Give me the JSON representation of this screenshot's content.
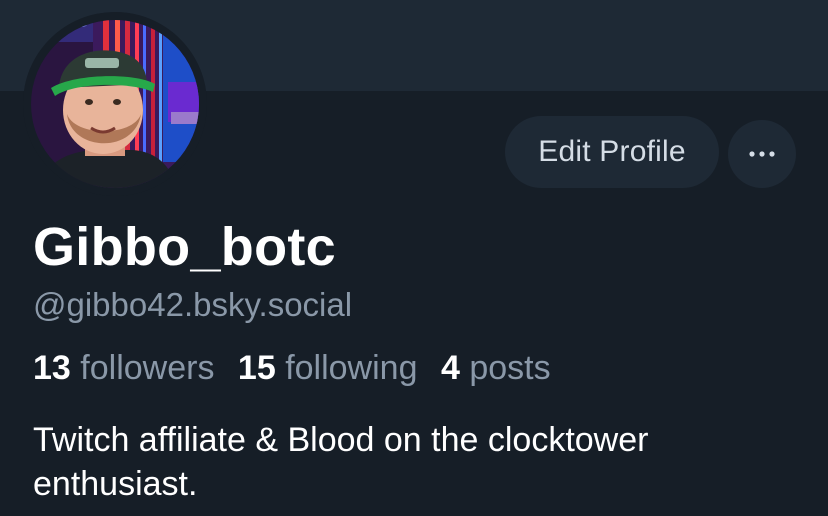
{
  "profile": {
    "display_name": "Gibbo_botc",
    "handle": "@gibbo42.bsky.social",
    "bio": "Twitch affiliate & Blood on the clocktower enthusiast.",
    "avatar_icon": "user-avatar-photo"
  },
  "actions": {
    "edit_profile_label": "Edit Profile",
    "more_icon": "ellipsis-icon"
  },
  "stats": {
    "followers_count": "13",
    "followers_label": "followers",
    "following_count": "15",
    "following_label": "following",
    "posts_count": "4",
    "posts_label": "posts"
  },
  "colors": {
    "background": "#161e27",
    "banner": "#1e2935",
    "button_bg": "#1e2935",
    "muted_text": "#8a98a8",
    "primary_text": "#ffffff"
  }
}
